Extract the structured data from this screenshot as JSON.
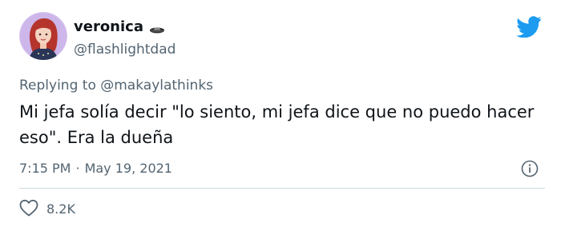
{
  "user": {
    "display_name": "veronica",
    "handle": "@flashlightdad",
    "avatar_icon": "profile-avatar",
    "badge_icon": "ufo-icon"
  },
  "reply": {
    "prefix": "Replying to",
    "mention": "@makaylathinks"
  },
  "tweet": {
    "text": "Mi jefa solía decir \"lo siento, mi jefa dice que no puedo hacer eso\". Era la dueña",
    "time": "7:15 PM",
    "separator": "·",
    "date": "May 19, 2021"
  },
  "stats": {
    "likes": "8.2K",
    "like_icon": "heart-icon"
  },
  "brand": {
    "icon": "twitter-bird-icon",
    "color": "#1d9bf0"
  },
  "colors": {
    "text": "#0f1419",
    "secondary": "#536471",
    "divider": "#cfd9de"
  }
}
